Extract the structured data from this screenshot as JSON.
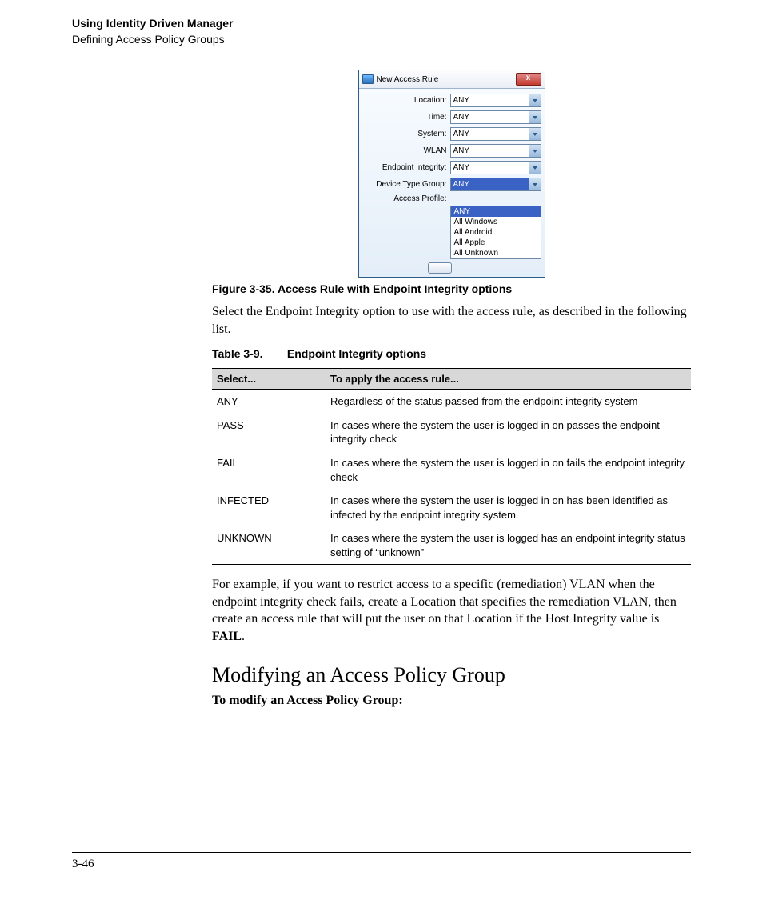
{
  "header": {
    "chapter": "Using Identity Driven Manager",
    "section": "Defining Access Policy Groups"
  },
  "dialog": {
    "title": "New Access Rule",
    "close_glyph": "x",
    "fields": {
      "location": {
        "label": "Location:",
        "value": "ANY"
      },
      "time": {
        "label": "Time:",
        "value": "ANY"
      },
      "system": {
        "label": "System:",
        "value": "ANY"
      },
      "wlan": {
        "label": "WLAN",
        "value": "ANY"
      },
      "endpoint": {
        "label": "Endpoint Integrity:",
        "value": "ANY"
      },
      "device": {
        "label": "Device Type Group:",
        "value": "ANY"
      },
      "profile": {
        "label": "Access Profile:"
      }
    },
    "dropdown_options": [
      "ANY",
      "All Windows",
      "All Android",
      "All Apple",
      "All Unknown"
    ]
  },
  "figure_caption": "Figure 3-35. Access Rule with Endpoint Integrity options",
  "intro_para": "Select the Endpoint Integrity option to use with the access rule, as described in the following list.",
  "table_caption": {
    "num": "Table 3-9.",
    "title": "Endpoint Integrity options"
  },
  "table": {
    "headers": [
      "Select...",
      "To apply the access rule..."
    ],
    "rows": [
      {
        "select": "ANY",
        "desc": "Regardless of the status passed from the endpoint integrity system"
      },
      {
        "select": "PASS",
        "desc": "In cases where the system the user is logged in on passes the endpoint integrity check"
      },
      {
        "select": "FAIL",
        "desc": "In cases where the system the user is logged in on fails the endpoint integrity check"
      },
      {
        "select": "INFECTED",
        "desc": "In cases where the system the user is logged in on has been identified as infected by the endpoint integrity system"
      },
      {
        "select": "UNKNOWN",
        "desc": "In cases where the system the user is logged has an endpoint integrity status setting of “unknown”"
      }
    ]
  },
  "example_para": {
    "pre": "For example, if you want to restrict access to a specific (remediation) VLAN when the endpoint integrity check fails, create a Location that specifies the remediation VLAN, then create an access rule that will put the user on that Location if the Host Integrity value is ",
    "bold": "FAIL",
    "post": "."
  },
  "heading": "Modifying an Access Policy Group",
  "sub_bold": "To modify an Access Policy Group:",
  "page_number": "3-46"
}
